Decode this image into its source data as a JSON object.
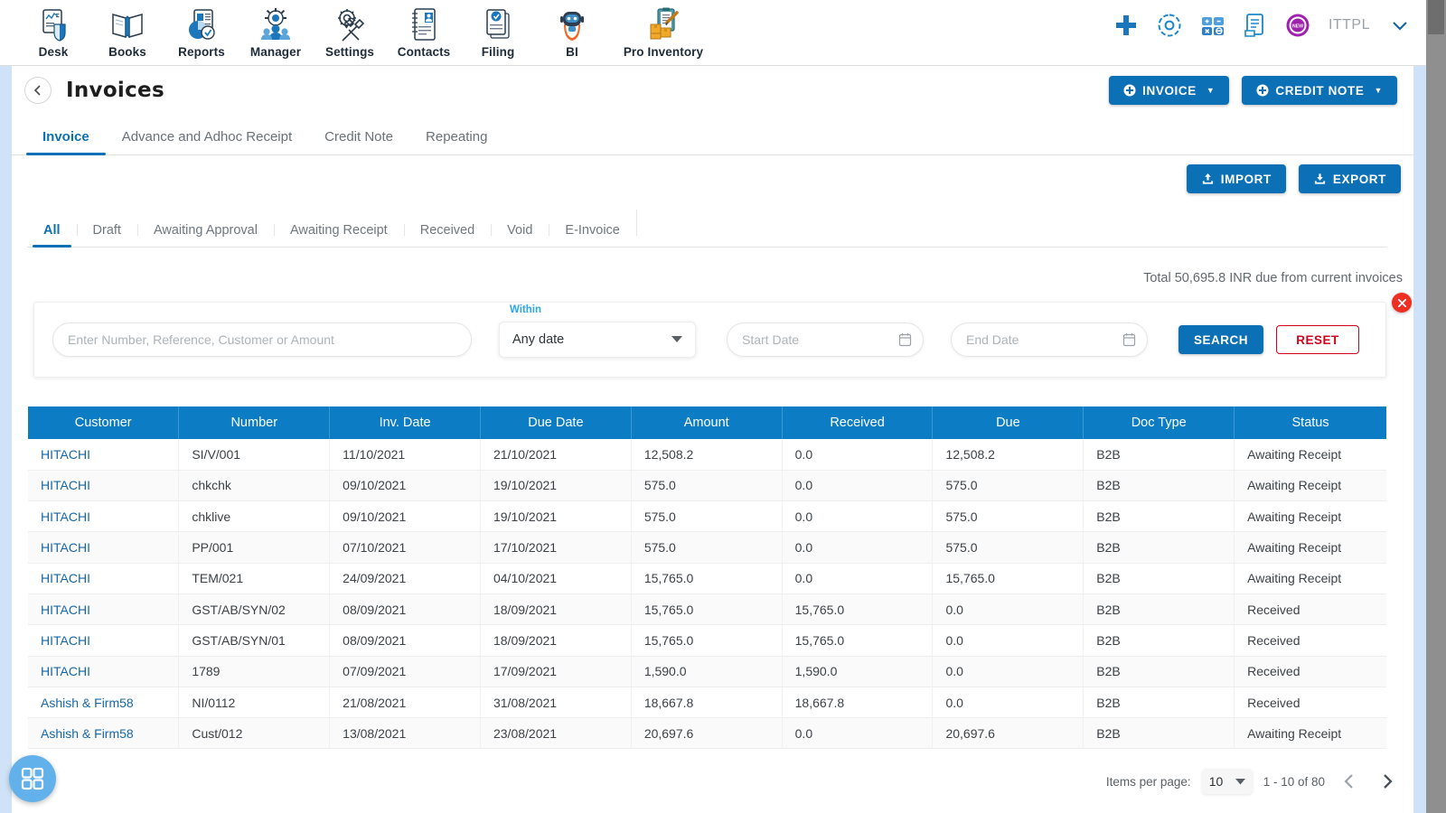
{
  "appbar": {
    "apps": [
      {
        "label": "Desk",
        "icon": "desk-icon"
      },
      {
        "label": "Books",
        "icon": "books-icon"
      },
      {
        "label": "Reports",
        "icon": "reports-icon"
      },
      {
        "label": "Manager",
        "icon": "manager-icon"
      },
      {
        "label": "Settings",
        "icon": "settings-icon"
      },
      {
        "label": "Contacts",
        "icon": "contacts-icon"
      },
      {
        "label": "Filing",
        "icon": "filing-icon"
      },
      {
        "label": "BI",
        "icon": "bi-robot-icon"
      },
      {
        "label": "Pro Inventory",
        "icon": "pro-inventory-icon"
      }
    ],
    "org_name": "ITTPL",
    "right_icons": [
      "plus-icon",
      "gear-icon",
      "calculator-icon",
      "document-icon",
      "new-badge-icon",
      "chevron-down-icon"
    ]
  },
  "page": {
    "title": "Invoices",
    "back_icon": "chevron-left-icon"
  },
  "header_actions": {
    "invoice_label": "INVOICE",
    "credit_note_label": "CREDIT NOTE"
  },
  "main_tabs": [
    {
      "label": "Invoice",
      "active": true
    },
    {
      "label": "Advance and Adhoc Receipt",
      "active": false
    },
    {
      "label": "Credit Note",
      "active": false
    },
    {
      "label": "Repeating",
      "active": false
    }
  ],
  "io_buttons": {
    "import_label": "IMPORT",
    "export_label": "EXPORT"
  },
  "status_tabs": [
    {
      "label": "All",
      "active": true
    },
    {
      "label": "Draft",
      "active": false
    },
    {
      "label": "Awaiting Approval",
      "active": false
    },
    {
      "label": "Awaiting Receipt",
      "active": false
    },
    {
      "label": "Received",
      "active": false
    },
    {
      "label": "Void",
      "active": false
    },
    {
      "label": "E-Invoice",
      "active": false
    }
  ],
  "total_line": "Total 50,695.8 INR due from current invoices",
  "filter": {
    "search_placeholder": "Enter Number, Reference, Customer or Amount",
    "search_value": "",
    "within_label": "Within",
    "within_value": "Any date",
    "start_date_placeholder": "Start Date",
    "start_date_value": "",
    "end_date_placeholder": "End Date",
    "end_date_value": "",
    "search_button": "SEARCH",
    "reset_button": "RESET",
    "close_icon": "close-icon"
  },
  "table": {
    "columns": [
      "Customer",
      "Number",
      "Inv. Date",
      "Due Date",
      "Amount",
      "Received",
      "Due",
      "Doc Type",
      "Status"
    ],
    "rows": [
      {
        "customer": "HITACHI",
        "number": "SI/V/001",
        "inv_date": "11/10/2021",
        "due_date": "21/10/2021",
        "amount": "12,508.2",
        "received": "0.0",
        "due": "12,508.2",
        "doc_type": "B2B",
        "status": "Awaiting Receipt"
      },
      {
        "customer": "HITACHI",
        "number": "chkchk",
        "inv_date": "09/10/2021",
        "due_date": "19/10/2021",
        "amount": "575.0",
        "received": "0.0",
        "due": "575.0",
        "doc_type": "B2B",
        "status": "Awaiting Receipt"
      },
      {
        "customer": "HITACHI",
        "number": "chklive",
        "inv_date": "09/10/2021",
        "due_date": "19/10/2021",
        "amount": "575.0",
        "received": "0.0",
        "due": "575.0",
        "doc_type": "B2B",
        "status": "Awaiting Receipt"
      },
      {
        "customer": "HITACHI",
        "number": "PP/001",
        "inv_date": "07/10/2021",
        "due_date": "17/10/2021",
        "amount": "575.0",
        "received": "0.0",
        "due": "575.0",
        "doc_type": "B2B",
        "status": "Awaiting Receipt"
      },
      {
        "customer": "HITACHI",
        "number": "TEM/021",
        "inv_date": "24/09/2021",
        "due_date": "04/10/2021",
        "amount": "15,765.0",
        "received": "0.0",
        "due": "15,765.0",
        "doc_type": "B2B",
        "status": "Awaiting Receipt"
      },
      {
        "customer": "HITACHI",
        "number": "GST/AB/SYN/02",
        "inv_date": "08/09/2021",
        "due_date": "18/09/2021",
        "amount": "15,765.0",
        "received": "15,765.0",
        "due": "0.0",
        "doc_type": "B2B",
        "status": "Received"
      },
      {
        "customer": "HITACHI",
        "number": "GST/AB/SYN/01",
        "inv_date": "08/09/2021",
        "due_date": "18/09/2021",
        "amount": "15,765.0",
        "received": "15,765.0",
        "due": "0.0",
        "doc_type": "B2B",
        "status": "Received"
      },
      {
        "customer": "HITACHI",
        "number": "1789",
        "inv_date": "07/09/2021",
        "due_date": "17/09/2021",
        "amount": "1,590.0",
        "received": "1,590.0",
        "due": "0.0",
        "doc_type": "B2B",
        "status": "Received"
      },
      {
        "customer": "Ashish & Firm58",
        "number": "NI/0112",
        "inv_date": "21/08/2021",
        "due_date": "31/08/2021",
        "amount": "18,667.8",
        "received": "18,667.8",
        "due": "0.0",
        "doc_type": "B2B",
        "status": "Received"
      },
      {
        "customer": "Ashish & Firm58",
        "number": "Cust/012",
        "inv_date": "13/08/2021",
        "due_date": "23/08/2021",
        "amount": "20,697.6",
        "received": "0.0",
        "due": "20,697.6",
        "doc_type": "B2B",
        "status": "Awaiting Receipt"
      }
    ]
  },
  "paginator": {
    "items_per_page_label": "Items per page:",
    "items_per_page_value": "10",
    "range_label": "1 - 10 of 80",
    "prev_icon": "chevron-left-icon",
    "next_icon": "chevron-right-icon"
  },
  "fab": {
    "icon": "grid-apps-icon"
  },
  "colors": {
    "accent": "#0c70b6",
    "table_header": "#0c7cc4",
    "link": "#1668a8",
    "danger": "#d0021b",
    "close_chip": "#ef2f21",
    "within_label": "#2ea6e8",
    "rail": "#cfe2f7",
    "fab": "#63b1ea"
  }
}
